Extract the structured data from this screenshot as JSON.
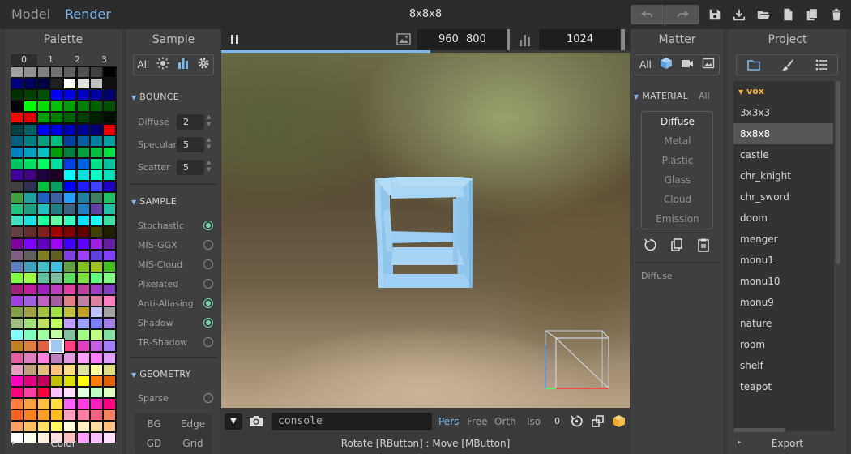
{
  "topbar": {
    "mode_model": "Model",
    "mode_render": "Render",
    "title": "8x8x8",
    "accent": "#7fb6ea"
  },
  "palette": {
    "title": "Palette",
    "tabs": [
      "0",
      "1",
      "2",
      "3"
    ],
    "footer": "Color",
    "colors": [
      "#a0a0a0",
      "#909090",
      "#808080",
      "#707070",
      "#606060",
      "#505050",
      "#404040",
      "#000000",
      "#000080",
      "#000060",
      "#000040",
      "#202020",
      "#ffffff",
      "#e0e0e0",
      "#c0c0c0",
      "#101010",
      "#003000",
      "#004000",
      "#005000",
      "#0000ff",
      "#0000e0",
      "#0000c0",
      "#0000a0",
      "#000070",
      "#000000",
      "#00ff00",
      "#00e000",
      "#00c000",
      "#00a000",
      "#008000",
      "#006000",
      "#005000",
      "#ff0000",
      "#e00000",
      "#00a000",
      "#008000",
      "#006000",
      "#004000",
      "#002000",
      "#001000",
      "#004040",
      "#006060",
      "#0000ff",
      "#0000dd",
      "#0000bb",
      "#000099",
      "#000077",
      "#ee0000",
      "#006080",
      "#008080",
      "#00a080",
      "#00c080",
      "#0040a0",
      "#0060a0",
      "#0080a0",
      "#00a0a0",
      "#0080c0",
      "#00a0c0",
      "#00c0c0",
      "#00a000",
      "#008040",
      "#00a040",
      "#00c040",
      "#00e040",
      "#00c060",
      "#00e060",
      "#00ff60",
      "#00e0a0",
      "#0040e0",
      "#0060e0",
      "#00e080",
      "#00c0a0",
      "#4000a0",
      "#400080",
      "#200040",
      "#200020",
      "#00ffff",
      "#00e0e0",
      "#00ffc0",
      "#00e0c0",
      "#404040",
      "#303050",
      "#00c040",
      "#00a060",
      "#0000ff",
      "#2020ff",
      "#4040ff",
      "#2000c0",
      "#40a040",
      "#20a0a0",
      "#2060c0",
      "#4060a0",
      "#20a0ff",
      "#2080a0",
      "#408060",
      "#20c060",
      "#20c080",
      "#20a080",
      "#20c0c0",
      "#208080",
      "#406080",
      "#2080c0",
      "#6040a0",
      "#20c0a0",
      "#40e0c0",
      "#20e0e0",
      "#20ffa0",
      "#60ffa0",
      "#40ffc0",
      "#00e0ff",
      "#20ffff",
      "#40e0a0",
      "#604040",
      "#603030",
      "#802020",
      "#a00000",
      "#800000",
      "#600000",
      "#404000",
      "#202000",
      "#8000a0",
      "#8000ff",
      "#6000c0",
      "#a000ff",
      "#4000ff",
      "#6000ff",
      "#a020e0",
      "#6020a0",
      "#806080",
      "#606060",
      "#808020",
      "#606020",
      "#8040e0",
      "#a040ff",
      "#6040e0",
      "#8040ff",
      "#6080c0",
      "#40a0c0",
      "#40c0c0",
      "#40c0e0",
      "#60a040",
      "#80c020",
      "#a0c020",
      "#40c020",
      "#80ff40",
      "#a0ff40",
      "#60c0a0",
      "#80c0a0",
      "#60e060",
      "#80e040",
      "#60ff80",
      "#80ff80",
      "#a02080",
      "#c020a0",
      "#a020c0",
      "#c040c0",
      "#e040a0",
      "#c040a0",
      "#a040c0",
      "#8040c0",
      "#a040e0",
      "#a060e0",
      "#c060c0",
      "#a060a0",
      "#e08080",
      "#c080a0",
      "#e080a0",
      "#ff80c0",
      "#80a040",
      "#a0a040",
      "#a0c040",
      "#a0e040",
      "#c0c040",
      "#c0a020",
      "#c0c0ff",
      "#a0a0a0",
      "#a0c080",
      "#a0e080",
      "#c0e060",
      "#c0ff60",
      "#c0a0ff",
      "#a0a0ff",
      "#8080ff",
      "#a080e0",
      "#80ffff",
      "#80ffc0",
      "#a0ffa0",
      "#c0ffa0",
      "#80c0a0",
      "#a0ff80",
      "#c0ff80",
      "#80e0a0",
      "#c08020",
      "#e08040",
      "#e06040",
      "#ff60a0",
      "#ff4080",
      "#e040c0",
      "#c060e0",
      "#a080ff",
      "#e060a0",
      "#e080c0",
      "#ff80e0",
      "#c080c0",
      "#e0a0e0",
      "#ffa0ff",
      "#ff80ff",
      "#e0a0ff",
      "#e0a0c0",
      "#c0a080",
      "#e0c080",
      "#ffc080",
      "#ffe080",
      "#e0e0a0",
      "#ffffa0",
      "#e0e080",
      "#ff00c0",
      "#e00080",
      "#c00060",
      "#c0c000",
      "#e0e000",
      "#ffff00",
      "#ff8000",
      "#e06000",
      "#ff0080",
      "#ff40a0",
      "#ff0040",
      "#ffc0ff",
      "#ffe0ff",
      "#e0ffe0",
      "#c0ffc0",
      "#e0ffc0",
      "#ff8040",
      "#ffa040",
      "#ffc040",
      "#ffe040",
      "#ff60ff",
      "#ff40e0",
      "#ff20c0",
      "#ff0080",
      "#ff6020",
      "#ff8020",
      "#ffa020",
      "#ffc020",
      "#ffa0c0",
      "#ff80a0",
      "#ff6080",
      "#ff8060",
      "#ffa060",
      "#ffc060",
      "#ffe060",
      "#ffff60",
      "#ffffe0",
      "#fff0c0",
      "#ffe0a0",
      "#ffc080",
      "#ffffff",
      "#fffff0",
      "#fff0e0",
      "#ffe0e0",
      "#ffc0c0",
      "#ffa0ff",
      "#ffc0ff",
      "#ffe0ff"
    ],
    "selected_color": "#a0c8f0"
  },
  "sample": {
    "title": "Sample",
    "filter_all": "All",
    "bounce": {
      "title": "BOUNCE",
      "rows": [
        {
          "label": "Diffuse",
          "value": "2"
        },
        {
          "label": "Specular",
          "value": "5"
        },
        {
          "label": "Scatter",
          "value": "5"
        }
      ]
    },
    "sample_group": {
      "title": "SAMPLE",
      "options": [
        {
          "label": "Stochastic",
          "on": true
        },
        {
          "label": "MIS-GGX",
          "on": false
        },
        {
          "label": "MIS-Cloud",
          "on": false
        },
        {
          "label": "Pixelated",
          "on": false
        },
        {
          "label": "Anti-Aliasing",
          "on": true
        },
        {
          "label": "Shadow",
          "on": true
        },
        {
          "label": "TR-Shadow",
          "on": false
        }
      ]
    },
    "geometry": {
      "title": "GEOMETRY",
      "sparse": "Sparse",
      "buttons": [
        "BG",
        "Edge",
        "GD",
        "Grid"
      ]
    }
  },
  "viewport": {
    "width": "960",
    "height": "800",
    "samples": "1024",
    "console_placeholder": "console",
    "views": [
      "Pers",
      "Free",
      "Orth",
      "Iso"
    ],
    "active_view": "Pers",
    "counter": "0",
    "status": "Rotate [RButton] : Move [MButton]"
  },
  "matter": {
    "title": "Matter",
    "filter_all": "All",
    "material_title": "MATERIAL",
    "material_all": "All",
    "materials": [
      "Diffuse",
      "Metal",
      "Plastic",
      "Glass",
      "Cloud",
      "Emission"
    ],
    "selected_material": "Diffuse",
    "selected_label": "Diffuse"
  },
  "project": {
    "title": "Project",
    "folder": "vox",
    "items": [
      "3x3x3",
      "8x8x8",
      "castle",
      "chr_knight",
      "chr_sword",
      "doom",
      "menger",
      "monu1",
      "monu10",
      "monu9",
      "nature",
      "room",
      "shelf",
      "teapot"
    ],
    "selected": "8x8x8",
    "footer": "Export",
    "folder_color": "#f0b030"
  }
}
